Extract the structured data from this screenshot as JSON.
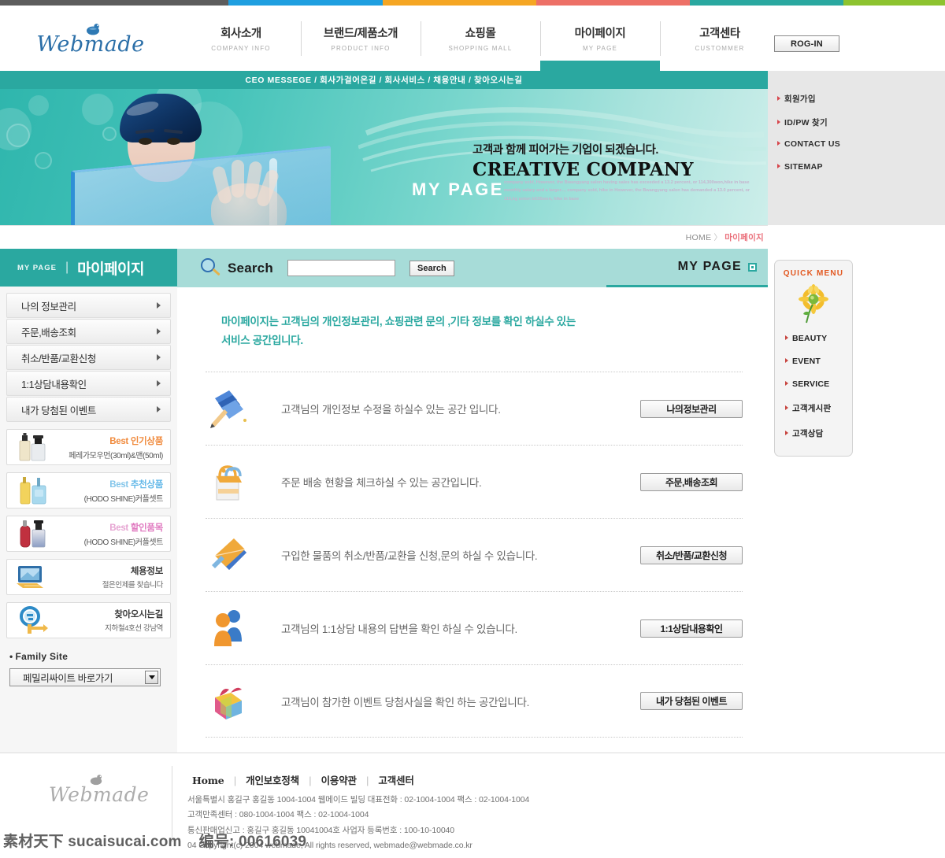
{
  "topbar": {
    "segments": [
      "#5d5d5d",
      "#1f9fe0",
      "#f5a623",
      "#ed7067",
      "#2aa8a0",
      "#8dc32f"
    ]
  },
  "header": {
    "logo_text": "Webmade",
    "login_label": "ROG-IN",
    "nav": [
      {
        "ko": "회사소개",
        "en": "COMPANY INFO",
        "active": false
      },
      {
        "ko": "브랜드/제품소개",
        "en": "PRODUCT INFO",
        "active": false
      },
      {
        "ko": "쇼핑몰",
        "en": "SHOPPING MALL",
        "active": false
      },
      {
        "ko": "마이페이지",
        "en": "MY PAGE",
        "active": true
      },
      {
        "ko": "고객센타",
        "en": "CUSTOMMER",
        "active": false
      }
    ]
  },
  "subnav": {
    "text": "CEO MESSEGE / 회사가걸어온길 / 회사서비스 / 채용안내 / 찾아오시는길"
  },
  "banner": {
    "headline": "고객과 함께 피어가는 기업이 되겠습니다.",
    "title": "CREATIVE COMPANY",
    "page_label": "MY PAGE",
    "lorem": "company sold, However, the Bwangyang salon having sales has exceeded a 13.2 percent, or 114,300won,hike in base monthly salary and a larger..., company sold, hike in However, the Bwangyang salon has demanded a 13.0 percent, or 115,kg union b63Swon, hike in base"
  },
  "member_links": [
    {
      "label": "회원가입"
    },
    {
      "label": "ID/PW 찾기"
    },
    {
      "label": "CONTACT US"
    },
    {
      "label": "SITEMAP"
    }
  ],
  "breadcrumb": {
    "home": "HOME",
    "sep": "〉",
    "current": "마이페이지"
  },
  "sidebar": {
    "head_en": "MY PAGE",
    "head_bar": "|",
    "head_ko": "마이페이지",
    "items": [
      {
        "label": "나의 정보관리"
      },
      {
        "label": "주문,배송조회"
      },
      {
        "label": "취소/반품/교환신청"
      },
      {
        "label": "1:1상담내용확인"
      },
      {
        "label": "내가 당첨된 이벤트"
      }
    ],
    "promos": [
      {
        "line1_best": "Best",
        "line1_rest": "인기상품",
        "line1_color": "#f08a3c",
        "line2": "페레가모우먼(30ml)&맨(50ml)",
        "icon": "perfume-pair-icon"
      },
      {
        "line1_best": "Best",
        "line1_rest": "추천상품",
        "line1_color": "#63b8e8",
        "line2": "(HODO SHINE)커플셋트",
        "icon": "perfume-blue-icon"
      },
      {
        "line1_best": "Best",
        "line1_rest": "할인품목",
        "line1_color": "#e07ac0",
        "line2": "(HODO SHINE)커플셋트",
        "icon": "perfume-red-icon"
      }
    ],
    "info_boxes": [
      {
        "title": "체용정보",
        "sub": "절은인제를 찾습니다",
        "icon": "monitor-recruit-icon"
      },
      {
        "title": "찾아오시는길",
        "sub": "지하철4호선 강남역",
        "icon": "magnifier-map-icon"
      }
    ],
    "family_site": {
      "label": "Family Site",
      "bullet": "•",
      "selected": "페밀리싸이트 바로가기"
    }
  },
  "main": {
    "search": {
      "label": "Search",
      "value": "",
      "placeholder": "",
      "button": "Search"
    },
    "tab_title": "MY PAGE",
    "intro": "마이페이지는  고객님의 개인정보관리, 쇼핑관련 문의 ,기타 정보를 확인 하실수 있는\n서비스 공간입니다.",
    "rows": [
      {
        "desc": "고객님의 개인정보 수정을 하실수 있는 공간 입니다.",
        "button": "나의정보관리",
        "icon": "books-pencil-icon"
      },
      {
        "desc": "주문 배송 현황을 체크하실 수 있는 공간입니다.",
        "button": "주문,배송조회",
        "icon": "shopping-bag-icon"
      },
      {
        "desc": "구입한 물품의 취소/반품/교환을 신청,문의 하실 수 있습니다.",
        "button": "취소/반품/교환신청",
        "icon": "envelope-arrow-icon"
      },
      {
        "desc": "고객님의 1:1상담 내용의 답변을 확인 하실 수 있습니다.",
        "button": "1:1상담내용확인",
        "icon": "two-people-icon"
      },
      {
        "desc": "고객님이 참가한 이벤트 당첨사실을 확인 하는 공간입니다.",
        "button": "내가 당첨된 이벤트",
        "icon": "gift-box-icon"
      }
    ]
  },
  "quick_menu": {
    "title": "QUICK MENU",
    "links": [
      {
        "label": "BEAUTY"
      },
      {
        "label": "EVENT"
      },
      {
        "label": "SERVICE"
      },
      {
        "label": "고객게시판"
      },
      {
        "label": "고객상담"
      }
    ]
  },
  "footer": {
    "logo_text": "Webmade",
    "links": [
      "Home",
      "개인보호정책",
      "이용약관",
      "고객센터"
    ],
    "sep": "|",
    "address_lines": [
      "서울특별시 홍길구 홍길동 1004-1004 웹메이드 빌딩    대표전화 : 02-1004-1004   팩스 : 02-1004-1004",
      "고객만족센터 : 080-1004-1004   팩스 : 02-1004-1004",
      "통신판매업신고 : 홍길구 홍길동 10041004호   사업자 등록번호 : 100-10-10040",
      "04  Copyright(c) 2004 webmade, All rights reserved, webmade@webmade.co.kr"
    ]
  },
  "watermark": {
    "left": "素材天下 sucaisucai.com",
    "right": "编号: 00616039"
  }
}
